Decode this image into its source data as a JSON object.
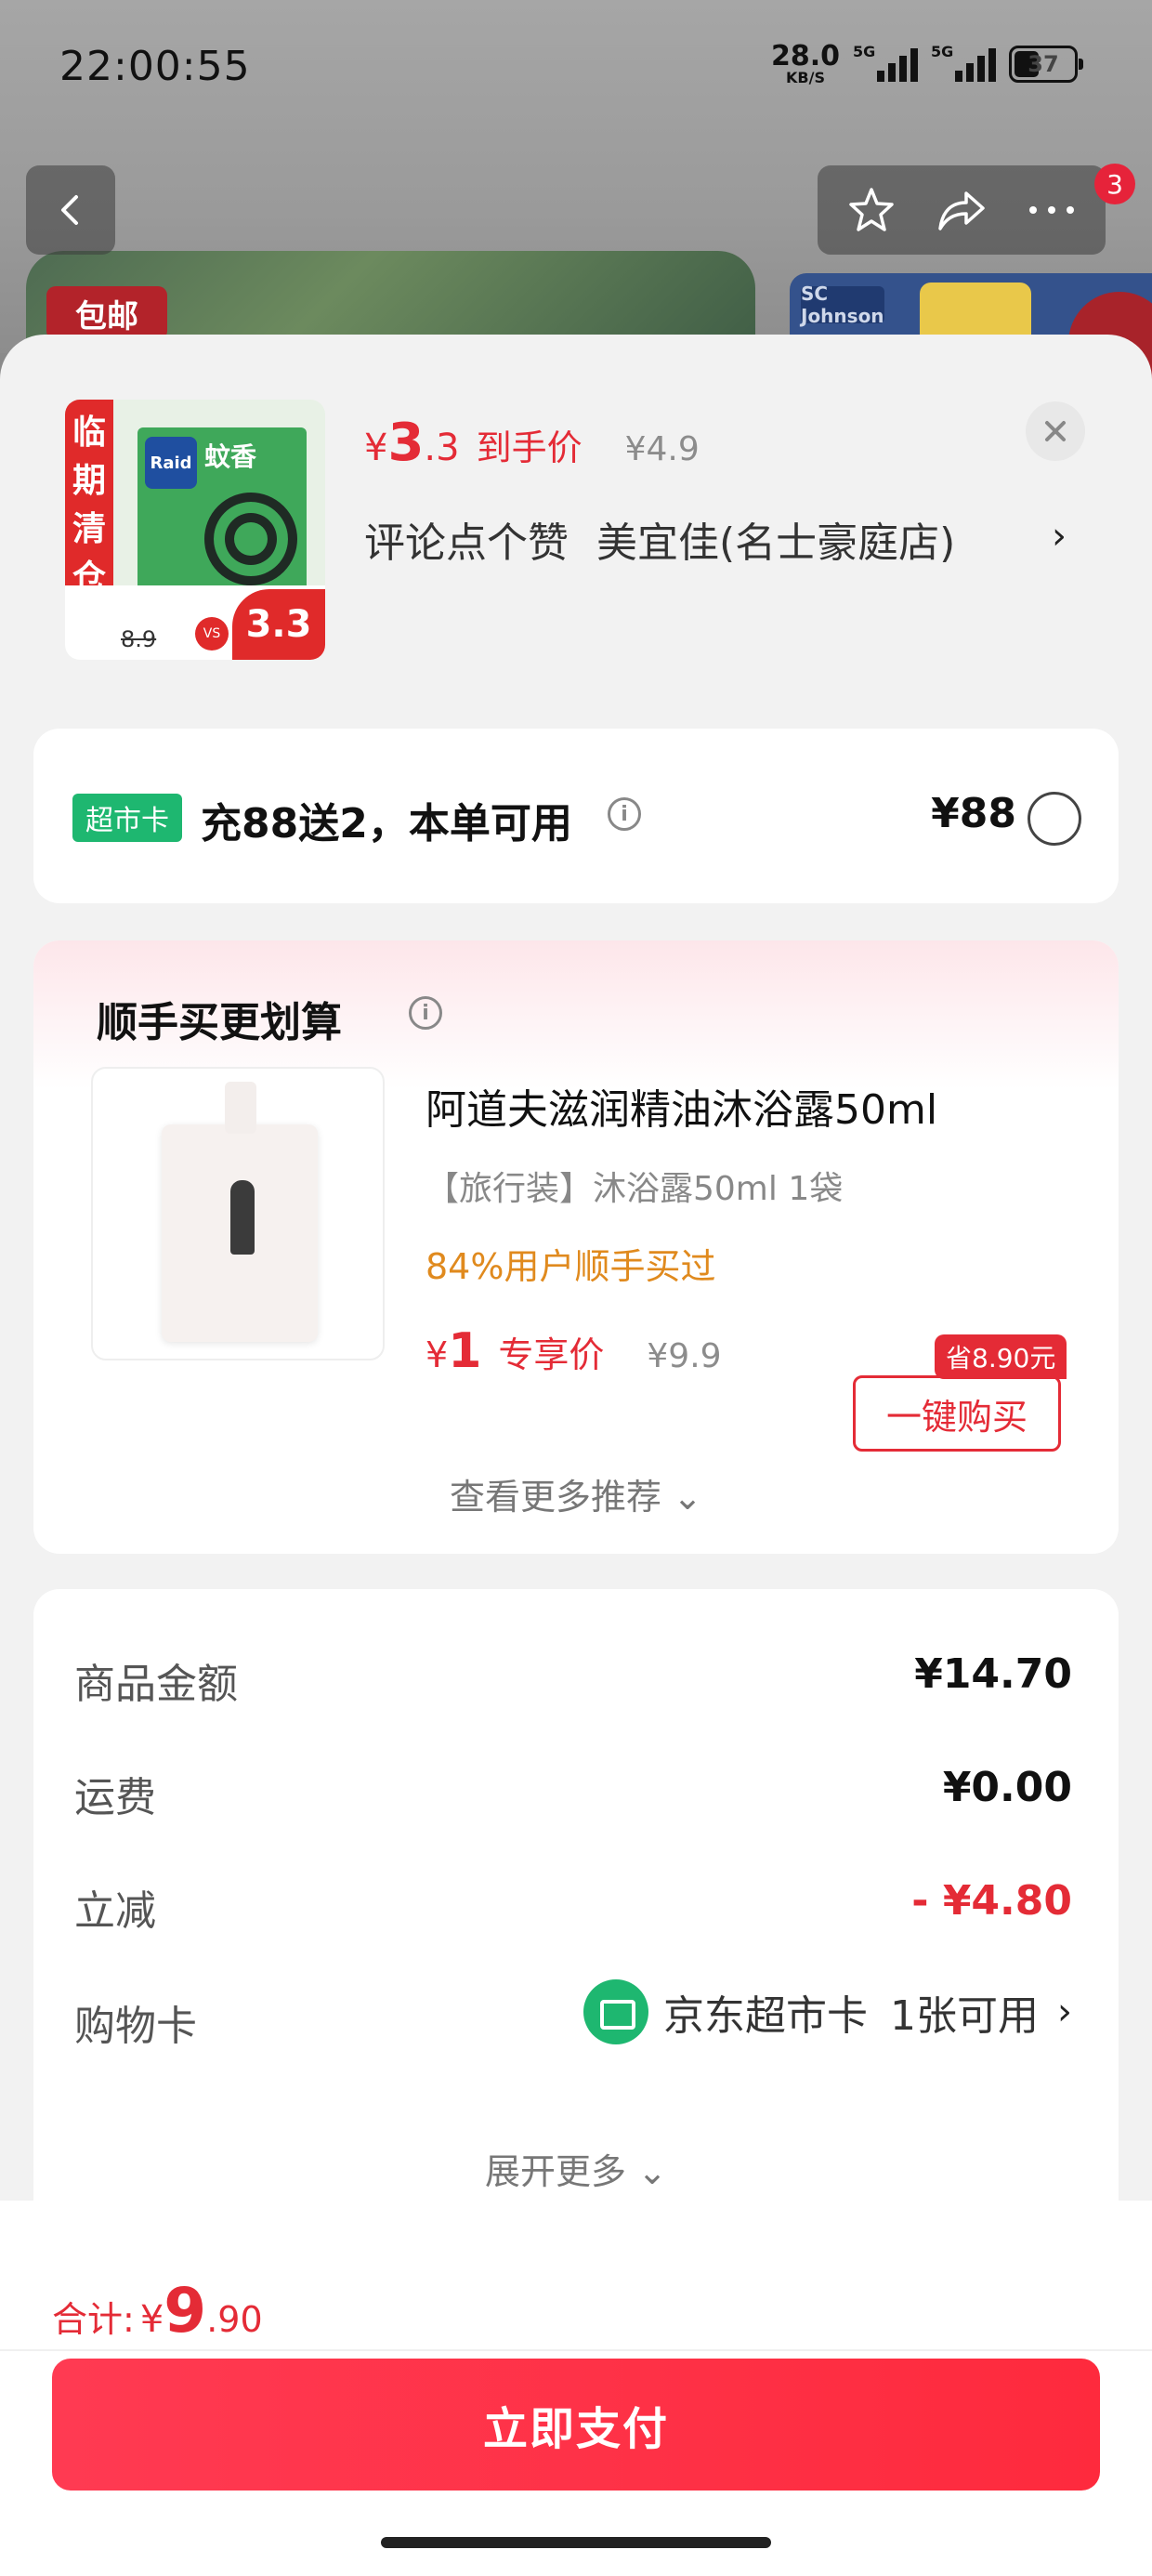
{
  "status_bar": {
    "time": "22:00:55",
    "net_speed": "28.0",
    "net_unit": "KB/S",
    "sim1": "5G",
    "sim2": "5G",
    "battery": "37"
  },
  "background": {
    "baoyou": "包邮"
  },
  "nav": {
    "badge_count": "3",
    "icons": [
      "back-icon",
      "star-icon",
      "share-icon",
      "more-icon"
    ]
  },
  "product": {
    "image_labels": {
      "clearance": "临期清仓",
      "brand": "Raid",
      "name": "蚊香",
      "old_price": "8.9",
      "vs": "VS",
      "new_price": "3.3"
    },
    "price_yen": "¥",
    "price_int": "3",
    "price_dec": ".3",
    "price_tag": "到手价",
    "original_price": "¥4.9",
    "promo": "评论点个赞",
    "store": "美宜佳(名士豪庭店)",
    "chevron": "›"
  },
  "supermarket_card": {
    "badge": "超市卡",
    "text": "充88送2，本单可用",
    "price": "¥88"
  },
  "recommend": {
    "title": "顺手买更划算",
    "item": {
      "name": "阿道夫滋润精油沐浴露50ml",
      "spec": "【旅行装】沐浴露50ml 1袋",
      "bought": "84%用户顺手买过",
      "price_yen": "¥",
      "price_int": "1",
      "price_tag": "专享价",
      "original_price": "¥9.9",
      "save_tag": "省8.90元",
      "buy_label": "一键购买"
    },
    "more": "查看更多推荐 ⌄"
  },
  "summary": {
    "rows": [
      {
        "label": "商品金额",
        "value": "¥14.70"
      },
      {
        "label": "运费",
        "value": "¥0.00"
      },
      {
        "label": "立减",
        "value": "- ¥4.80"
      }
    ],
    "card_label": "购物卡",
    "card_name": "京东超市卡",
    "card_count": "1张可用",
    "card_chevron": "›",
    "expand": "展开更多 ⌄"
  },
  "footer": {
    "total_label": "合计:",
    "total_yen": "¥",
    "total_int": "9",
    "total_dec": ".90",
    "pay_label": "立即支付"
  },
  "colors": {
    "accent": "#e42b36",
    "green": "#1eb770",
    "orange": "#e08a1e"
  }
}
